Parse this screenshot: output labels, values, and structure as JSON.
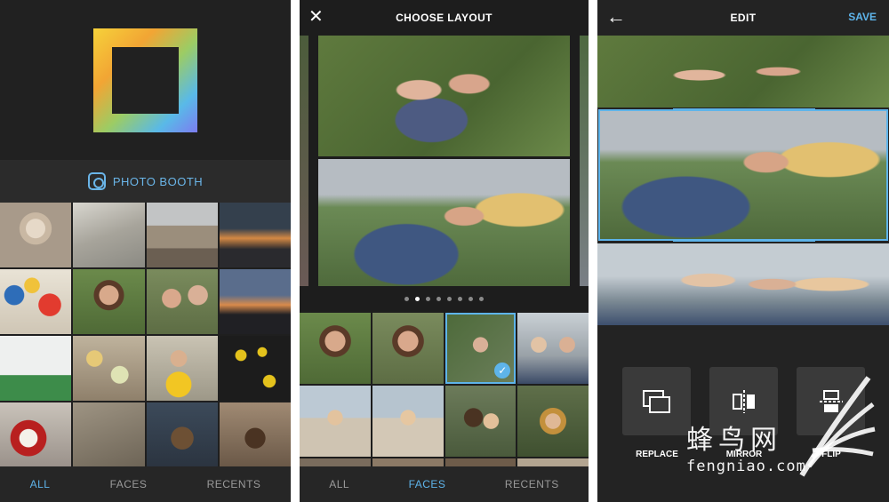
{
  "screen1": {
    "booth_label": "PHOTO BOOTH",
    "tabs": [
      {
        "label": "ALL",
        "active": true
      },
      {
        "label": "FACES",
        "active": false
      },
      {
        "label": "RECENTS",
        "active": false
      }
    ],
    "accent": "#5eb4ea"
  },
  "screen2": {
    "title": "CHOOSE LAYOUT",
    "page_dots": 8,
    "active_dot": 1,
    "tabs": [
      {
        "label": "ALL",
        "active": false
      },
      {
        "label": "FACES",
        "active": true
      },
      {
        "label": "RECENTS",
        "active": false
      }
    ]
  },
  "screen3": {
    "title": "EDIT",
    "save_label": "SAVE",
    "tools": [
      {
        "label": "REPLACE",
        "icon": "replace-icon"
      },
      {
        "label": "MIRROR",
        "icon": "mirror-icon"
      },
      {
        "label": "FLIP",
        "icon": "flip-icon"
      }
    ]
  },
  "watermark": {
    "chinese": "蜂鸟网",
    "url": "fengniao.com"
  }
}
